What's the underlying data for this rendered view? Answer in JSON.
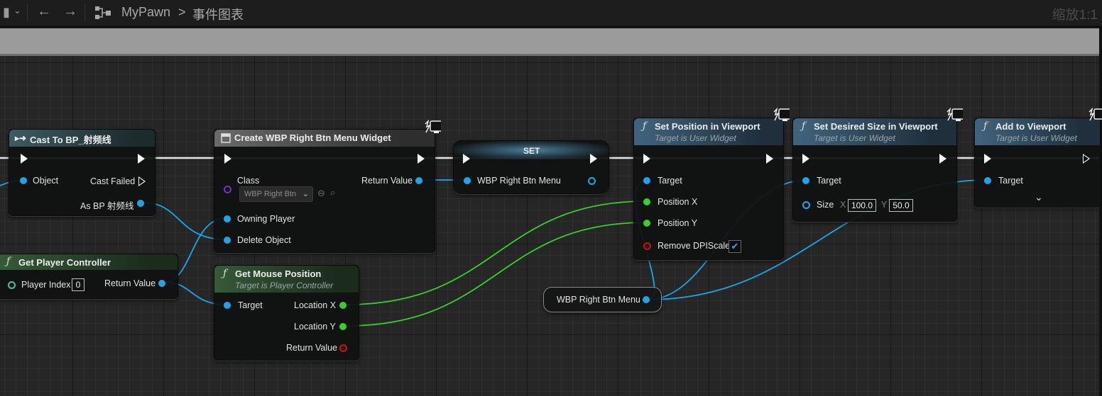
{
  "toolbar": {
    "asset": "MyPawn",
    "separator": ">",
    "graph": "事件图表",
    "zoom": "缩放1:1"
  },
  "nodes": {
    "cast": {
      "title": "Cast To BP_射频线",
      "object": "Object",
      "cast_failed": "Cast Failed",
      "as_bp": "As BP 射频线"
    },
    "create": {
      "title": "Create WBP Right Btn Menu Widget",
      "class": "Class",
      "class_value": "WBP Right Btn",
      "return_value": "Return Value",
      "owning_player": "Owning Player",
      "delete_object": "Delete Object"
    },
    "set": {
      "title": "SET",
      "var": "WBP Right Btn Menu"
    },
    "setpos": {
      "title": "Set Position in Viewport",
      "subtitle": "Target is User Widget",
      "target": "Target",
      "pos_x": "Position X",
      "pos_y": "Position Y",
      "remove_dpi": "Remove DPIScale",
      "remove_dpi_checked": "✔"
    },
    "setsize": {
      "title": "Set Desired Size in Viewport",
      "subtitle": "Target is User Widget",
      "target": "Target",
      "size": "Size",
      "x_label": "X",
      "x_value": "100.0",
      "y_label": "Y",
      "y_value": "50.0"
    },
    "addview": {
      "title": "Add to Viewport",
      "subtitle": "Target is User Widget",
      "target": "Target"
    },
    "getpc": {
      "title": "Get Player Controller",
      "player_index": "Player Index",
      "player_index_value": "0",
      "return_value": "Return Value"
    },
    "mouse": {
      "title": "Get Mouse Position",
      "subtitle": "Target is Player Controller",
      "target": "Target",
      "loc_x": "Location X",
      "loc_y": "Location Y",
      "return_value": "Return Value"
    },
    "getvar": {
      "label": "WBP Right Btn Menu"
    }
  },
  "colors": {
    "exec": "#f2f2f2",
    "object_pin": "#1aa6e8",
    "float_pin": "#37d12b",
    "bool_pin": "#c11717",
    "class_pin": "#7a30c8"
  },
  "icons": [
    "bookmark-icon",
    "chevron-down-icon",
    "back-arrow-icon",
    "forward-arrow-icon",
    "graph-icon",
    "function-icon",
    "cast-icon",
    "widget-icon",
    "monitor-badge-icon",
    "search-icon",
    "browse-icon"
  ]
}
